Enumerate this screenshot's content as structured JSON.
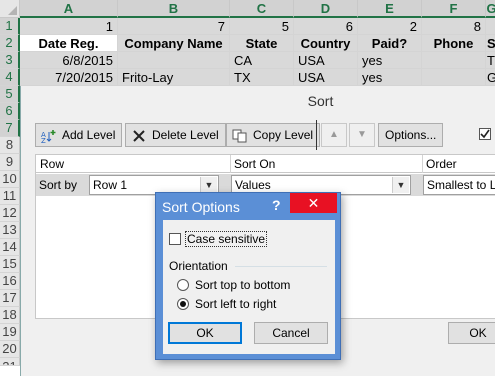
{
  "sheet": {
    "columns": [
      "A",
      "B",
      "C",
      "D",
      "E",
      "F",
      "G"
    ],
    "row_numbers": [
      "1",
      "2",
      "3",
      "4",
      "5",
      "6",
      "7",
      "8",
      "9",
      "10",
      "11",
      "12",
      "13",
      "14",
      "15",
      "16",
      "17",
      "18",
      "19",
      "20",
      "21"
    ],
    "row1": [
      "1",
      "7",
      "5",
      "6",
      "2",
      "8"
    ],
    "headers": [
      "Date Reg.",
      "Company Name",
      "State",
      "Country",
      "Paid?",
      "Phone",
      "St"
    ],
    "row3": [
      "6/8/2015",
      "",
      "CA",
      "USA",
      "yes",
      "",
      "T"
    ],
    "row4": [
      "7/20/2015",
      "Frito-Lay",
      "TX",
      "USA",
      "yes",
      "",
      "G"
    ]
  },
  "sort_dialog": {
    "title": "Sort",
    "add_level": "Add Level",
    "delete_level": "Delete Level",
    "copy_level": "Copy Level",
    "options": "Options...",
    "col_row": "Row",
    "col_sort_on": "Sort On",
    "col_order": "Order",
    "row_label": "Sort by",
    "row_value": "Row 1",
    "sort_on_value": "Values",
    "order_value": "Smallest to La",
    "ok": "OK"
  },
  "options_dialog": {
    "title": "Sort Options",
    "help": "?",
    "close": "✕",
    "case_sensitive": "Case sensitive",
    "orientation": "Orientation",
    "top_to_bottom": "Sort top to bottom",
    "left_to_right": "Sort left to right",
    "selected_orientation": "left_to_right",
    "ok": "OK",
    "cancel": "Cancel"
  },
  "colors": {
    "excel_green": "#217346",
    "dialog_blue": "#5b8fd6",
    "close_red": "#e81123"
  }
}
